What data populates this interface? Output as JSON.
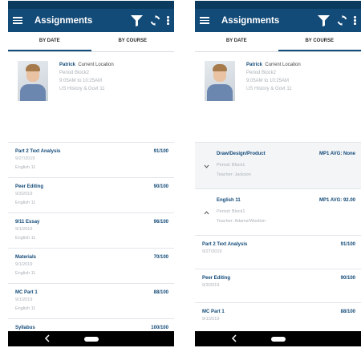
{
  "app": {
    "title": "Assignments"
  },
  "tabs": {
    "by_date": "BY DATE",
    "by_course": "BY COURSE"
  },
  "student": {
    "name": "Patrick",
    "location": "Current Location",
    "period": "Period Block2",
    "time": "9:05AM to 10:25AM",
    "course": "US History & Govt 11"
  },
  "by_date_list": [
    {
      "title": "Part 2 Text Analysis",
      "score": "91/100",
      "date": "9/27/2019",
      "course": "English 11"
    },
    {
      "title": "Peer Editing",
      "score": "90/100",
      "date": "9/3/2019",
      "course": "English 11"
    },
    {
      "title": "9/11 Essay",
      "score": "96/100",
      "date": "9/1/2019",
      "course": "English 11"
    },
    {
      "title": "Materials",
      "score": "70/100",
      "date": "9/1/2019",
      "course": "English 11"
    },
    {
      "title": "MC Part 1",
      "score": "88/100",
      "date": "9/1/2019",
      "course": "English 11"
    },
    {
      "title": "Syllabus",
      "score": "100/100",
      "date": "",
      "course": ""
    }
  ],
  "courses": [
    {
      "name": "Draw/Design/Product",
      "avg": "MP1 AVG: None",
      "period": "Period: Block1",
      "teacher": "Teacher: Jackson"
    },
    {
      "name": "English 11",
      "avg": "MP1 AVG: 92.00",
      "period": "Period: Block1",
      "teacher": "Teacher: Adams/Woolton"
    }
  ],
  "course_assignments": [
    {
      "title": "Part 2 Text Analysis",
      "score": "91/100",
      "date": "9/27/2019"
    },
    {
      "title": "Peer Editing",
      "score": "90/100",
      "date": "9/3/2019"
    },
    {
      "title": "MC Part 1",
      "score": "88/100",
      "date": "9/1/2019"
    }
  ],
  "colors": {
    "appbar": "#124a78",
    "statusbar": "#0a3a5e",
    "accent": "#124a78",
    "muted": "#a9b1b8"
  },
  "icons": [
    "menu-icon",
    "filter-icon",
    "sync-icon",
    "more-vert-icon",
    "chevron-down-icon",
    "chevron-up-icon",
    "back-icon",
    "home-icon"
  ]
}
